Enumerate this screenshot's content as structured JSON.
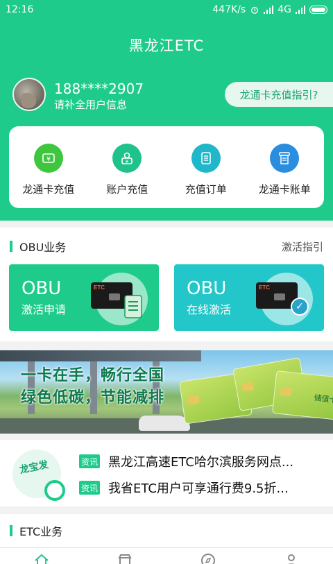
{
  "status_bar": {
    "time": "12:16",
    "network_speed": "447K/s",
    "network_type": "4G"
  },
  "header": {
    "title": "黑龙江ETC"
  },
  "user": {
    "phone": "188****2907",
    "prompt": "请补全用户信息",
    "guide_button": "龙通卡充值指引?"
  },
  "quick_actions": [
    {
      "label": "龙通卡充值",
      "icon": "card-yuan-icon",
      "color": "#3fc63f"
    },
    {
      "label": "账户充值",
      "icon": "account-yuan-icon",
      "color": "#20c28c"
    },
    {
      "label": "充值订单",
      "icon": "order-list-icon",
      "color": "#1fb7c9"
    },
    {
      "label": "龙通卡账单",
      "icon": "bill-icon",
      "color": "#2a8ee0"
    }
  ],
  "obu_section": {
    "title": "OBU业务",
    "link": "激活指引",
    "cards": [
      {
        "big": "OBU",
        "small": "激活申请",
        "color": "#1fcb8b"
      },
      {
        "big": "OBU",
        "small": "在线激活",
        "color": "#23c7c9"
      }
    ]
  },
  "banner": {
    "slogan_line1": "一卡在手，畅行全国",
    "slogan_line2": "绿色低碳，节能减排",
    "card_label": "储值卡"
  },
  "news": {
    "mascot_text": "龙宝发",
    "items": [
      {
        "tag": "资讯",
        "text": "黑龙江高速ETC哈尔滨服务网点..."
      },
      {
        "tag": "资讯",
        "text": "我省ETC用户可享通行费9.5折..."
      }
    ]
  },
  "etc_section": {
    "title": "ETC业务"
  },
  "colors": {
    "brand": "#1fcb8b",
    "background": "#f2f2f2"
  },
  "bottom_nav": [
    {
      "icon": "home-icon",
      "active": true
    },
    {
      "icon": "shop-icon",
      "active": false
    },
    {
      "icon": "compass-icon",
      "active": false
    },
    {
      "icon": "profile-icon",
      "active": false
    }
  ]
}
